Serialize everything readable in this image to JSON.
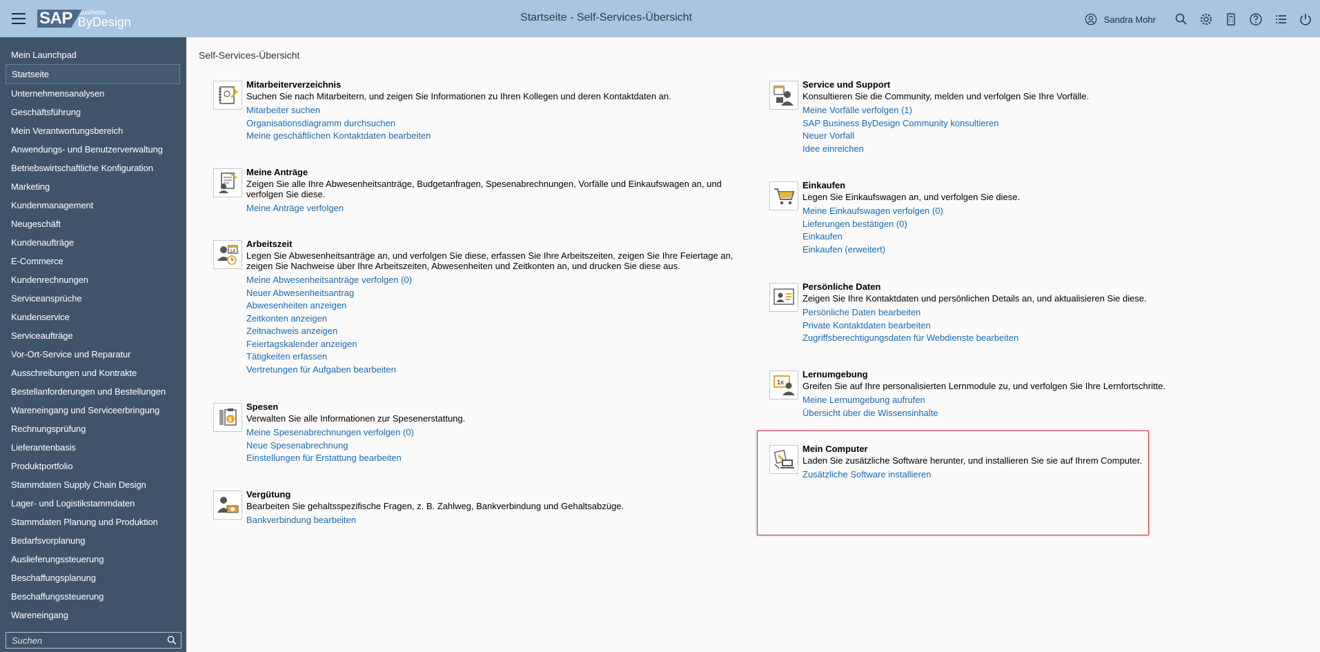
{
  "header": {
    "logo_sap": "SAP",
    "logo_business": "Business",
    "logo_bydesign": "ByDesign",
    "title": "Startseite - Self-Services-Übersicht",
    "user_name": "Sandra Mohr"
  },
  "sidebar": {
    "items": [
      "Mein Launchpad",
      "Startseite",
      "Unternehmensanalysen",
      "Geschäftsführung",
      "Mein Verantwortungsbereich",
      "Anwendungs- und Benutzerverwaltung",
      "Betriebswirtschaftliche Konfiguration",
      "Marketing",
      "Kundenmanagement",
      "Neugeschäft",
      "Kundenaufträge",
      "E-Commerce",
      "Kundenrechnungen",
      "Serviceansprüche",
      "Kundenservice",
      "Serviceaufträge",
      "Vor-Ort-Service und Reparatur",
      "Ausschreibungen und Kontrakte",
      "Bestellanforderungen und Bestellungen",
      "Wareneingang und Serviceerbringung",
      "Rechnungsprüfung",
      "Lieferantenbasis",
      "Produktportfolio",
      "Stammdaten Supply Chain Design",
      "Lager- und Logistikstammdaten",
      "Stammdaten Planung und Produktion",
      "Bedarfsvorplanung",
      "Auslieferungssteuerung",
      "Beschaffungsplanung",
      "Beschaffungssteuerung",
      "Wareneingang"
    ],
    "active_index": 1,
    "search_placeholder": "Suchen"
  },
  "main": {
    "page_label": "Self-Services-Übersicht",
    "left": [
      {
        "title": "Mitarbeiterverzeichnis",
        "description": "Suchen Sie nach Mitarbeitern, und zeigen Sie Informationen zu Ihren Kollegen und deren Kontaktdaten an.",
        "links": [
          "Mitarbeiter suchen",
          "Organisationsdiagramm durchsuchen",
          "Meine geschäftlichen Kontaktdaten bearbeiten"
        ]
      },
      {
        "title": "Meine Anträge",
        "description": "Zeigen Sie alle Ihre Abwesenheitsanträge, Budgetanfragen, Spesenabrechnungen, Vorfälle und Einkaufswagen an, und verfolgen Sie diese.",
        "links": [
          "Meine Anträge verfolgen"
        ]
      },
      {
        "title": "Arbeitszeit",
        "description": "Legen Sie Abwesenheitsanträge an, und verfolgen Sie diese, erfassen Sie Ihre Arbeitszeiten, zeigen Sie Ihre Feiertage an, zeigen Sie Nachweise über Ihre Arbeitszeiten, Abwesenheiten und Zeitkonten an, und drucken Sie diese aus.",
        "links": [
          "Meine Abwesenheitsanträge verfolgen (0)",
          "Neuer Abwesenheitsantrag",
          "Abwesenheiten anzeigen",
          "Zeitkonten anzeigen",
          "Zeitnachweis anzeigen",
          "Feiertagskalender anzeigen",
          "Tätigkeiten erfassen",
          "Vertretungen für Aufgaben bearbeiten"
        ]
      },
      {
        "title": "Spesen",
        "description": "Verwalten Sie alle Informationen zur Spesenerstattung.",
        "links": [
          "Meine Spesenabrechnungen verfolgen (0)",
          "Neue Spesenabrechnung",
          "Einstellungen für Erstattung bearbeiten"
        ]
      },
      {
        "title": "Vergütung",
        "description": "Bearbeiten Sie gehaltsspezifische Fragen, z. B. Zahlweg, Bankverbindung und Gehaltsabzüge.",
        "links": [
          "Bankverbindung bearbeiten"
        ]
      }
    ],
    "right": [
      {
        "title": "Service und Support",
        "description": "Konsultieren Sie die Community, melden und verfolgen Sie Ihre Vorfälle.",
        "links": [
          "Meine Vorfälle verfolgen (1)",
          "SAP Business ByDesign Community konsultieren",
          "Neuer Vorfall",
          "Idee einreichen"
        ]
      },
      {
        "title": "Einkaufen",
        "description": "Legen Sie Einkaufswagen an, und verfolgen Sie diese.",
        "links": [
          "Meine Einkaufswagen verfolgen (0)",
          "Lieferungen bestätigen (0)",
          "Einkaufen",
          "Einkaufen (erweitert)"
        ]
      },
      {
        "title": "Persönliche Daten",
        "description": "Zeigen Sie Ihre Kontaktdaten und persönlichen Details an, und aktualisieren Sie diese.",
        "links": [
          "Persönliche Daten bearbeiten",
          "Private Kontaktdaten bearbeiten",
          "Zugriffsberechtigungsdaten für Webdienste bearbeiten"
        ]
      },
      {
        "title": "Lernumgebung",
        "description": "Greifen Sie auf Ihre personalisierten Lernmodule zu, und verfolgen Sie Ihre Lernfortschritte.",
        "links": [
          "Meine Lernumgebung aufrufen",
          "Übersicht über die Wissensinhalte"
        ]
      },
      {
        "title": "Mein Computer",
        "description": "Laden Sie zusätzliche Software herunter, und installieren Sie sie auf Ihrem Computer.",
        "links": [
          "Zusätzliche Software installieren"
        ]
      }
    ]
  }
}
